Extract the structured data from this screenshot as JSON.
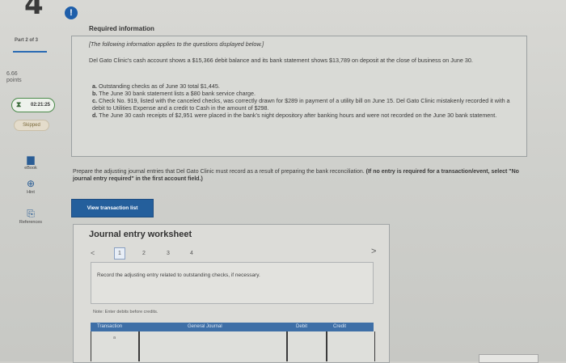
{
  "question": {
    "number": "4",
    "alert_glyph": "!"
  },
  "sidebar": {
    "part": "Part 2 of 3",
    "points_value": "6.66",
    "points_label": "points",
    "timer": "02:21:25",
    "skipped": "Skipped",
    "tools": [
      {
        "icon": "book-icon",
        "glyph": "▆",
        "label": "eBook"
      },
      {
        "icon": "hint-icon",
        "glyph": "⊕",
        "label": "Hint"
      },
      {
        "icon": "references-icon",
        "glyph": "⎘",
        "label": "References"
      }
    ]
  },
  "info": {
    "heading": "Required information",
    "intro": "[The following information applies to the questions displayed below.]",
    "paragraph": "Del Gato Clinic's cash account shows a $15,366 debit balance and its bank statement shows $13,789 on deposit at the close of business on June 30.",
    "items": [
      {
        "letter": "a.",
        "text": "Outstanding checks as of June 30 total $1,445."
      },
      {
        "letter": "b.",
        "text": "The June 30 bank statement lists a $80 bank service charge."
      },
      {
        "letter": "c.",
        "text": "Check No. 919, listed with the canceled checks, was correctly drawn for $289 in payment of a utility bill on June 15. Del Gato Clinic mistakenly recorded it with a debit to Utilities Expense and a credit to Cash in the amount of $298."
      },
      {
        "letter": "d.",
        "text": "The June 30 cash receipts of $2,951 were placed in the bank's night depository after banking hours and were not recorded on the June 30 bank statement."
      }
    ]
  },
  "prompt": {
    "text": "Prepare the adjusting journal entries that Del Gato Clinic must record as a result of preparing the bank reconciliation.",
    "emphasis": "(If no entry is required for a transaction/event, select \"No journal entry required\" in the first account field.)"
  },
  "view_button": "View transaction list",
  "worksheet": {
    "title": "Journal entry worksheet",
    "prev": "<",
    "next": ">",
    "steps": [
      "1",
      "2",
      "3",
      "4"
    ],
    "instruction": "Record the adjusting entry related to outstanding checks, if necessary.",
    "note": "Note: Enter debits before credits.",
    "columns": [
      "Transaction",
      "General Journal",
      "Debit",
      "Credit"
    ],
    "row_label": "a"
  },
  "colors": {
    "accent": "#245f9c",
    "table_header": "#3e6fa7",
    "timer_border": "#4a8a4a"
  }
}
